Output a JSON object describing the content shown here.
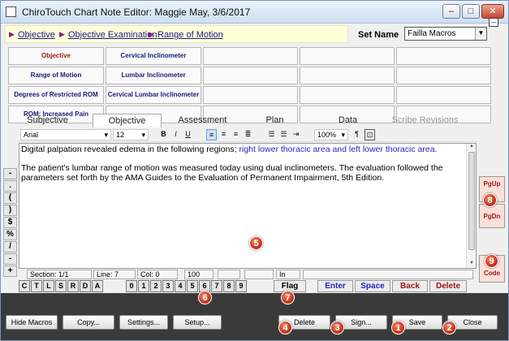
{
  "window": {
    "title": "ChiroTouch Chart Note Editor: Maggie May, 3/6/2017"
  },
  "crumbs": [
    "Objective",
    "Objective Examination",
    "Range of Motion"
  ],
  "set_name": {
    "label": "Set Name",
    "value": "Failla Macros"
  },
  "grid": [
    [
      "Objective",
      "Cervical Inclinometer"
    ],
    [
      "Range of Motion",
      "Lumbar Inclinometer"
    ],
    [
      "Degrees of Restricted ROM",
      "Cervical Lumbar Inclinometer"
    ],
    [
      "ROM: Increased Pain",
      ""
    ]
  ],
  "tabs": [
    "Subjective",
    "Objective",
    "Assessment",
    "Plan",
    "Data",
    "Scribe Revisions"
  ],
  "toolbar": {
    "font": "Arial",
    "size": "12",
    "bold": "B",
    "italic": "I",
    "underline": "U",
    "zoom": "100%",
    "pilcrow": "¶"
  },
  "editor": {
    "line1a": "Digital  palpation revealed edema in the following regions; ",
    "line1b": "right lower thoracic area and left lower thoracic area.",
    "para2": "The patient's lumbar range of motion was measured today using dual inclinometers. The evaluation followed the parameters set forth by the AMA Guides to the Evaluation of Permanent Impairment, 5th Edition."
  },
  "status": {
    "section": "Section: 1/1",
    "line": "Line: 7",
    "col": "Col: 0",
    "zoom": "100",
    "mode": "In"
  },
  "side_keys": [
    "-",
    ".",
    "(",
    ")",
    "$",
    "%",
    "/",
    "-",
    "+"
  ],
  "page_buttons": {
    "pgup": "PgUp",
    "pgdn": "PgDn",
    "code": "Code"
  },
  "letter_keys": [
    "C",
    "T",
    "L",
    "S",
    "R",
    "D",
    "A"
  ],
  "number_keys": [
    "0",
    "1",
    "2",
    "3",
    "4",
    "5",
    "6",
    "7",
    "8",
    "9"
  ],
  "flag": "Flag",
  "action_keys": {
    "enter": "Enter",
    "space": "Space",
    "back": "Back",
    "delete": "Delete"
  },
  "bottom_buttons": {
    "hide_macros": "Hide Macros",
    "copy": "Copy...",
    "settings": "Settings...",
    "setup": "Setup...",
    "delete": "Delete",
    "sign": "Sign...",
    "save": "Save",
    "close": "Close"
  },
  "markers": [
    "1",
    "2",
    "3",
    "4",
    "5",
    "6",
    "7",
    "8",
    "9"
  ],
  "window_controls": {
    "minimize": "‒",
    "maximize": "□",
    "close": "✕"
  },
  "colors": {
    "accent_red": "#a01818",
    "link_blue": "#1a1a8c",
    "enter_blue": "#2323c8",
    "marker_red": "#c8341c"
  }
}
